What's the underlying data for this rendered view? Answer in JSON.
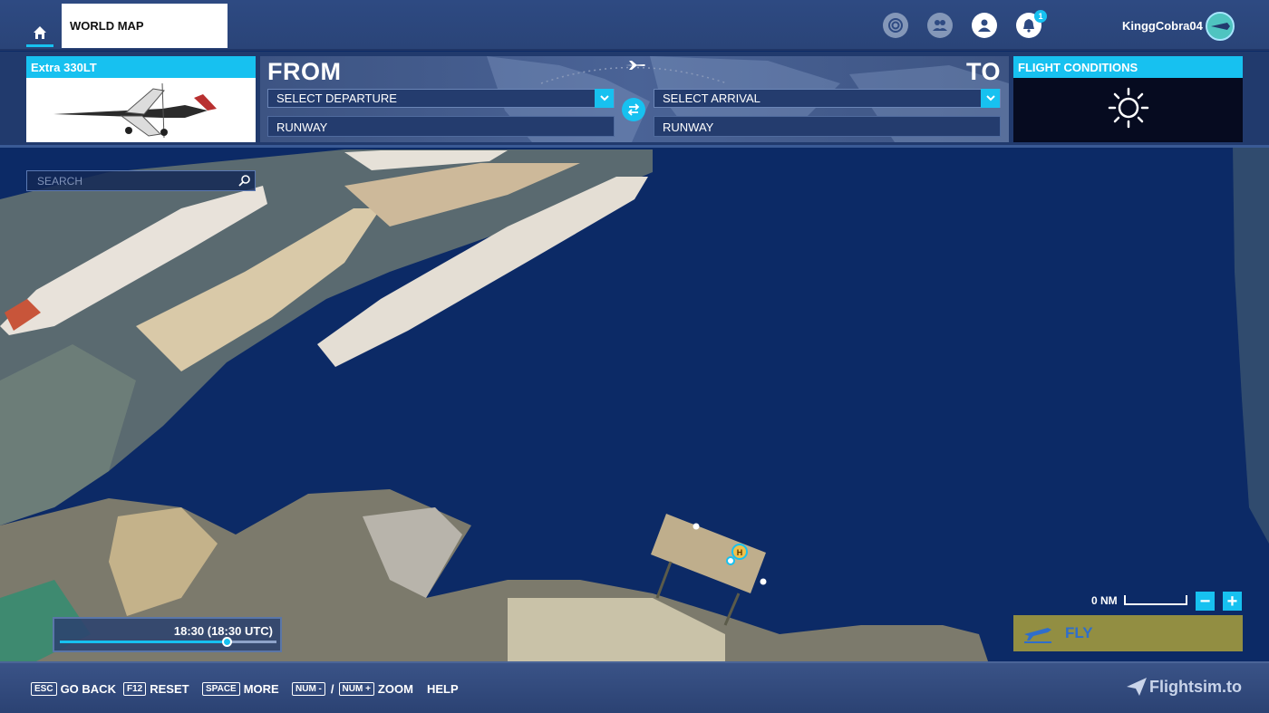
{
  "header": {
    "home_icon": "home-icon",
    "tab_label": "WORLD MAP",
    "icons": [
      "activity-icon",
      "friends-icon",
      "profile-icon",
      "notifications-icon"
    ],
    "notification_count": "1",
    "username": "KinggCobra04"
  },
  "aircraft": {
    "name": "Extra 330LT"
  },
  "route": {
    "from_label": "FROM",
    "to_label": "TO",
    "departure_placeholder": "SELECT DEPARTURE",
    "arrival_placeholder": "SELECT ARRIVAL",
    "departure_runway": "RUNWAY",
    "arrival_runway": "RUNWAY",
    "swap_icon": "swap-arrows-icon"
  },
  "conditions": {
    "title": "FLIGHT CONDITIONS",
    "weather_icon": "sun-icon"
  },
  "search": {
    "placeholder": "SEARCH"
  },
  "map": {
    "scale_label": "0 NM",
    "zoom_out": "−",
    "zoom_in": "+",
    "heliport_marker": "H"
  },
  "time": {
    "label": "18:30 (18:30 UTC)",
    "slider_fraction": 0.77
  },
  "fly": {
    "label": "FLY",
    "icon": "plane-takeoff-icon"
  },
  "footer": {
    "hints": [
      {
        "key": "ESC",
        "label": "GO BACK"
      },
      {
        "key": "F12",
        "label": "RESET"
      },
      {
        "key": "SPACE",
        "label": "MORE"
      }
    ],
    "zoom_key_minus": "NUM -",
    "zoom_separator": "/",
    "zoom_key_plus": "NUM +",
    "zoom_label": "ZOOM",
    "help_label": "HELP",
    "brand": "Flightsim.to"
  },
  "colors": {
    "accent": "#17c1f0",
    "water": "#0c2a66",
    "panel": "#2e4a82"
  }
}
